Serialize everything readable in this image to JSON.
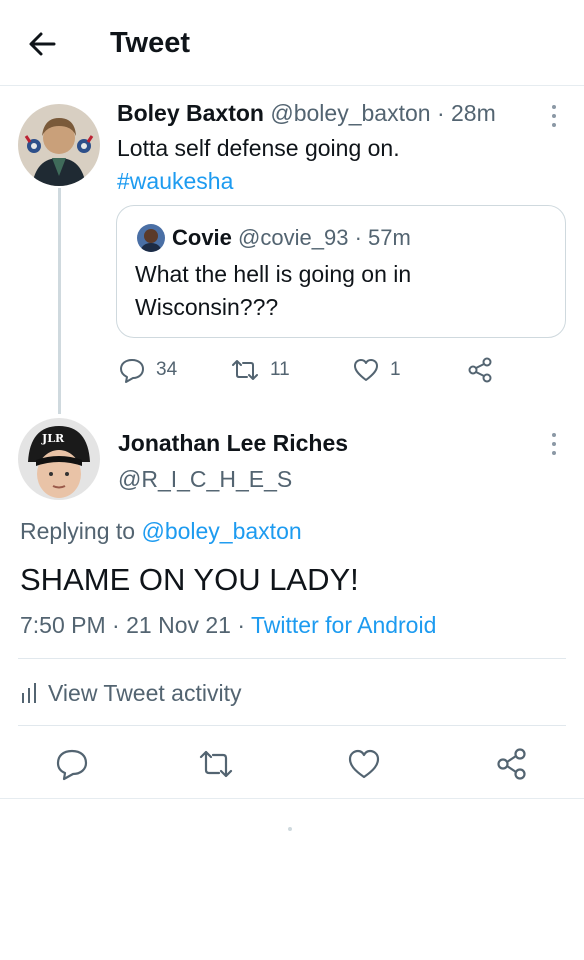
{
  "header": {
    "title": "Tweet"
  },
  "parent_tweet": {
    "name": "Boley Baxton",
    "handle": "@boley_baxton",
    "separator": "·",
    "time": "28m",
    "text": "Lotta self defense going on.",
    "hashtag": "#waukesha",
    "quoted": {
      "name": "Covie",
      "handle": "@covie_93",
      "separator": "·",
      "time": "57m",
      "text": "What the hell is going on in Wisconsin???"
    },
    "actions": {
      "replies": "34",
      "retweets": "11",
      "likes": "1"
    }
  },
  "main_tweet": {
    "name": "Jonathan Lee Riches",
    "handle": "@R_I_C_H_E_S",
    "replying_prefix": "Replying to",
    "replying_to": "@boley_baxton",
    "text": "SHAME ON YOU LADY!",
    "time": "7:50 PM",
    "date": "21 Nov 21",
    "separator": "·",
    "source": "Twitter for Android",
    "activity_label": "View Tweet activity",
    "avatar_cap_text": "JLR"
  },
  "colors": {
    "accent": "#1d9bf0",
    "muted": "#536471",
    "text": "#0f1419",
    "border": "#cfd9de"
  }
}
